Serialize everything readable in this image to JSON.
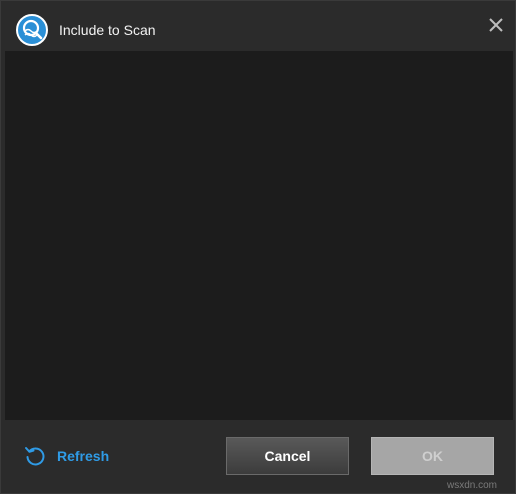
{
  "window": {
    "title": "Include to Scan",
    "app_icon": "shield-search-icon",
    "close_icon": "close-icon"
  },
  "footer": {
    "refresh_label": "Refresh",
    "refresh_icon": "refresh-icon",
    "cancel_label": "Cancel",
    "ok_label": "OK"
  },
  "watermark": "wsxdn.com",
  "colors": {
    "accent": "#2f9be6",
    "content_bg": "#1c1c1c",
    "dialog_bg": "#2b2b2b"
  }
}
